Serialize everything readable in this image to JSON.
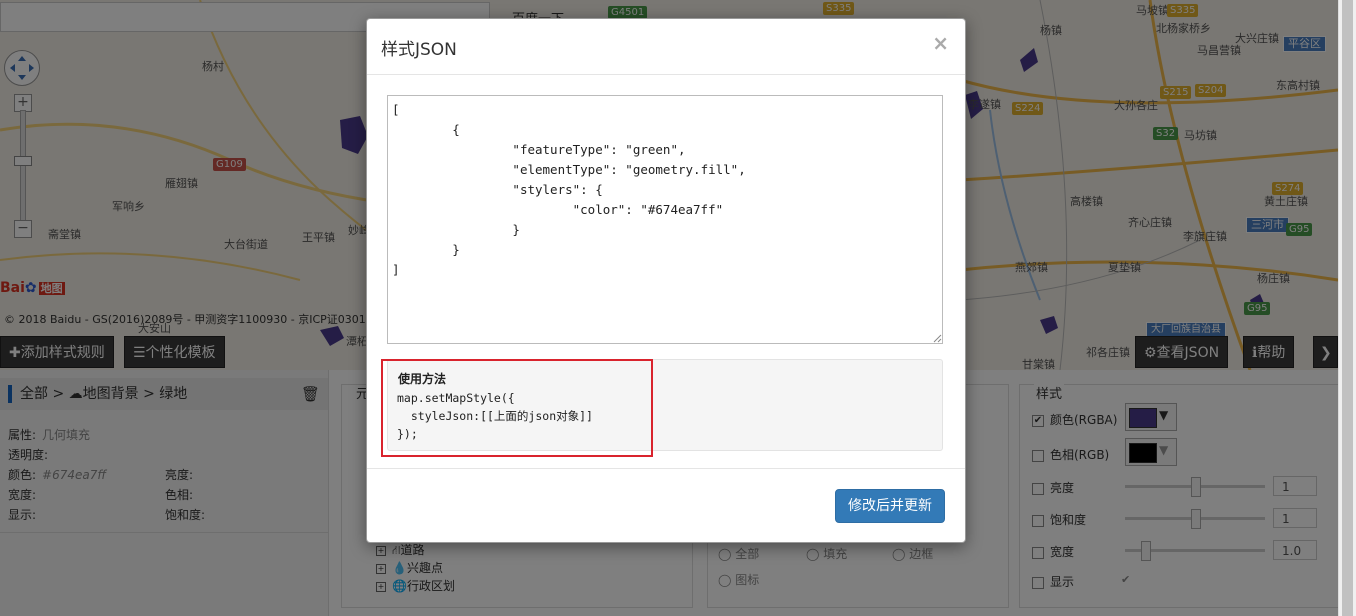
{
  "map": {
    "search_hint": "百度一下",
    "labels": [
      "杨村",
      "雁翅镇",
      "军响乡",
      "斋堂镇",
      "大台街道",
      "王平镇",
      "妙峰",
      "潭柘寺",
      "大安山",
      "马坡镇",
      "杨镇",
      "北杨家桥乡",
      "大孙各庄",
      "马坊镇",
      "高楼镇",
      "齐心庄镇",
      "燕郊镇",
      "夏垫镇",
      "李旗庄镇",
      "杨庄镇",
      "黄土庄镇",
      "东高村镇",
      "马昌营镇",
      "大兴庄镇",
      "李遂镇",
      "甘棠镇",
      "祁各庄镇",
      "大厂回族自治县",
      "三河市",
      "平谷区"
    ],
    "shields": [
      "G4501",
      "S335",
      "S335",
      "S215",
      "S204",
      "S224",
      "S32",
      "S274",
      "G95",
      "G95",
      "G109"
    ],
    "copyright": "© 2018 Baidu - GS(2016)2089号 - 甲测资字1100930 - 京ICP证030173号",
    "logo_text": "Bai",
    "logo_map": "地图"
  },
  "toolbar": {
    "add_rule": "✚添加样式规则",
    "template": "☰个性化模板",
    "view_json": "⚙查看JSON",
    "help": "ℹ帮助",
    "more": "❯"
  },
  "properties": {
    "crumb": [
      "全部",
      ">",
      "☁地图背景",
      ">",
      "绿地"
    ],
    "attr_label": "属性:",
    "attr_value": "几何填充",
    "opacity_label": "透明度:",
    "color_label": "颜色:",
    "color_value": "#674ea7ff",
    "brightness_label": "亮度:",
    "width_label": "宽度:",
    "hue_label": "色相:",
    "visible_label": "显示:",
    "saturation_label": "饱和度:"
  },
  "tree": {
    "section_title": "元",
    "items": [
      "道路",
      "兴趣点",
      "行政区划"
    ]
  },
  "element_type": {
    "options": [
      "全部",
      "填充",
      "边框",
      "图标"
    ]
  },
  "style_panel": {
    "title": "样式",
    "rows": [
      {
        "label": "颜色(RGBA)",
        "checked": true,
        "color": "#4a3a8c"
      },
      {
        "label": "色相(RGB)",
        "checked": false,
        "color": "#000000"
      },
      {
        "label": "亮度",
        "checked": false,
        "value": "1"
      },
      {
        "label": "饱和度",
        "checked": false,
        "value": "1"
      },
      {
        "label": "宽度",
        "checked": false,
        "value": "1.0"
      },
      {
        "label": "显示",
        "checked": false,
        "check2": "✔"
      }
    ]
  },
  "modal": {
    "title": "样式JSON",
    "close": "×",
    "json_text": "[\n\t{\n\t\t\"featureType\": \"green\",\n\t\t\"elementType\": \"geometry.fill\",\n\t\t\"stylers\": {\n\t\t\t\"color\": \"#674ea7ff\"\n\t\t}\n\t}\n]",
    "usage_title": "使用方法",
    "usage_code": "map.setMapStyle({\n  styleJson:[[上面的json对象]]\n});",
    "update_button": "修改后并更新"
  },
  "colors": {
    "accent": "#337ab7",
    "highlight": "#d9232d",
    "green_area": "#4a3a8c"
  }
}
